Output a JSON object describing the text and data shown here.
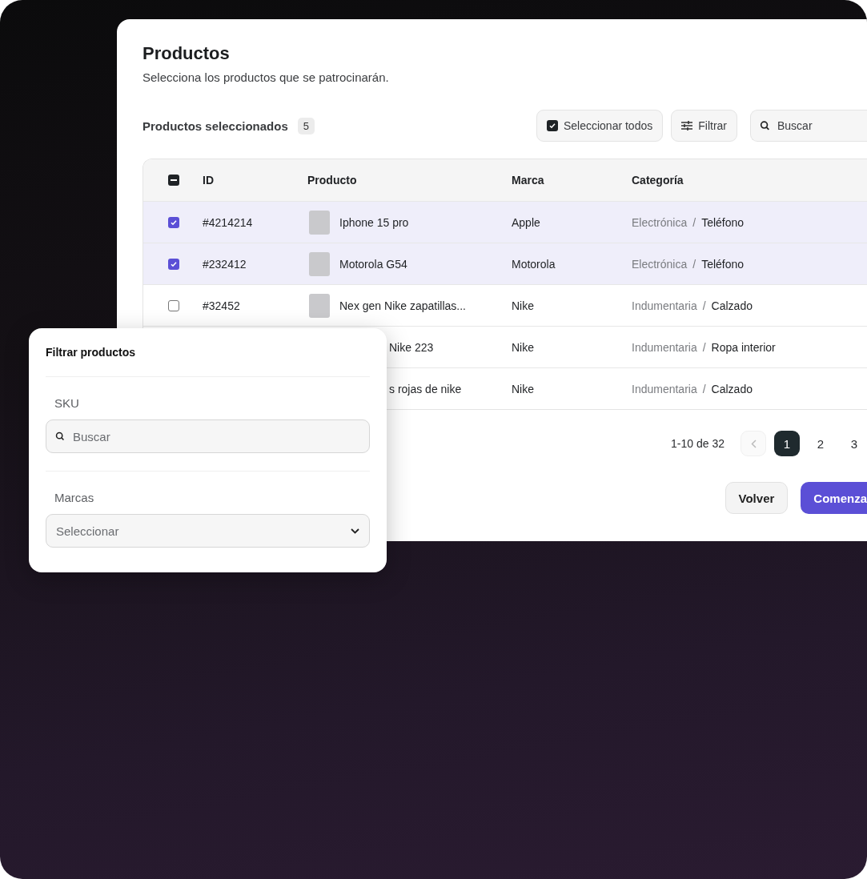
{
  "card": {
    "title": "Productos",
    "subtitle": "Selecciona los productos que se patrocinarán."
  },
  "toolbar": {
    "selected_label": "Productos seleccionados",
    "selected_count": "5",
    "select_all": {
      "label": "Seleccionar todos",
      "checked": true
    },
    "filter_button": "Filtrar",
    "search": {
      "placeholder": "Buscar"
    }
  },
  "table": {
    "header_checkbox": {
      "indeterminate": true
    },
    "columns": [
      "ID",
      "Producto",
      "Marca",
      "Categoría"
    ],
    "rows": [
      {
        "kind": "full",
        "checked": true,
        "selected": true,
        "id": "#4214214",
        "product": "Iphone 15 pro",
        "brand": "Apple",
        "category": "Electrónica",
        "separator": "/",
        "subcategory": "Teléfono"
      },
      {
        "kind": "full",
        "checked": true,
        "selected": true,
        "id": "#232412",
        "product": "Motorola G54",
        "brand": "Motorola",
        "category": "Electrónica",
        "separator": "/",
        "subcategory": "Teléfono"
      },
      {
        "kind": "full",
        "checked": false,
        "selected": false,
        "id": "#32452",
        "product": "Nex gen Nike zapatillas...",
        "brand": "Nike",
        "category": "Indumentaria",
        "separator": "/",
        "subcategory": "Calzado"
      },
      {
        "kind": "partial",
        "product": "Nike 223",
        "brand": "Nike",
        "category": "Indumentaria",
        "separator": "/",
        "subcategory": "Ropa interior"
      },
      {
        "kind": "partial",
        "product": "s rojas de nike",
        "brand": "Nike",
        "category": "Indumentaria",
        "separator": "/",
        "subcategory": "Calzado"
      }
    ]
  },
  "pagination": {
    "range": "1-10 de 32",
    "prev_disabled": true,
    "pages": [
      {
        "label": "1",
        "selected": true
      },
      {
        "label": "2",
        "selected": false
      },
      {
        "label": "3",
        "selected": false
      }
    ]
  },
  "actions": {
    "back": "Volver",
    "start": "Comenza"
  },
  "filter_panel": {
    "title": "Filtrar productos",
    "sku_label": "SKU",
    "sku_placeholder": "Buscar",
    "brands_label": "Marcas",
    "brands_placeholder": "Seleccionar"
  }
}
